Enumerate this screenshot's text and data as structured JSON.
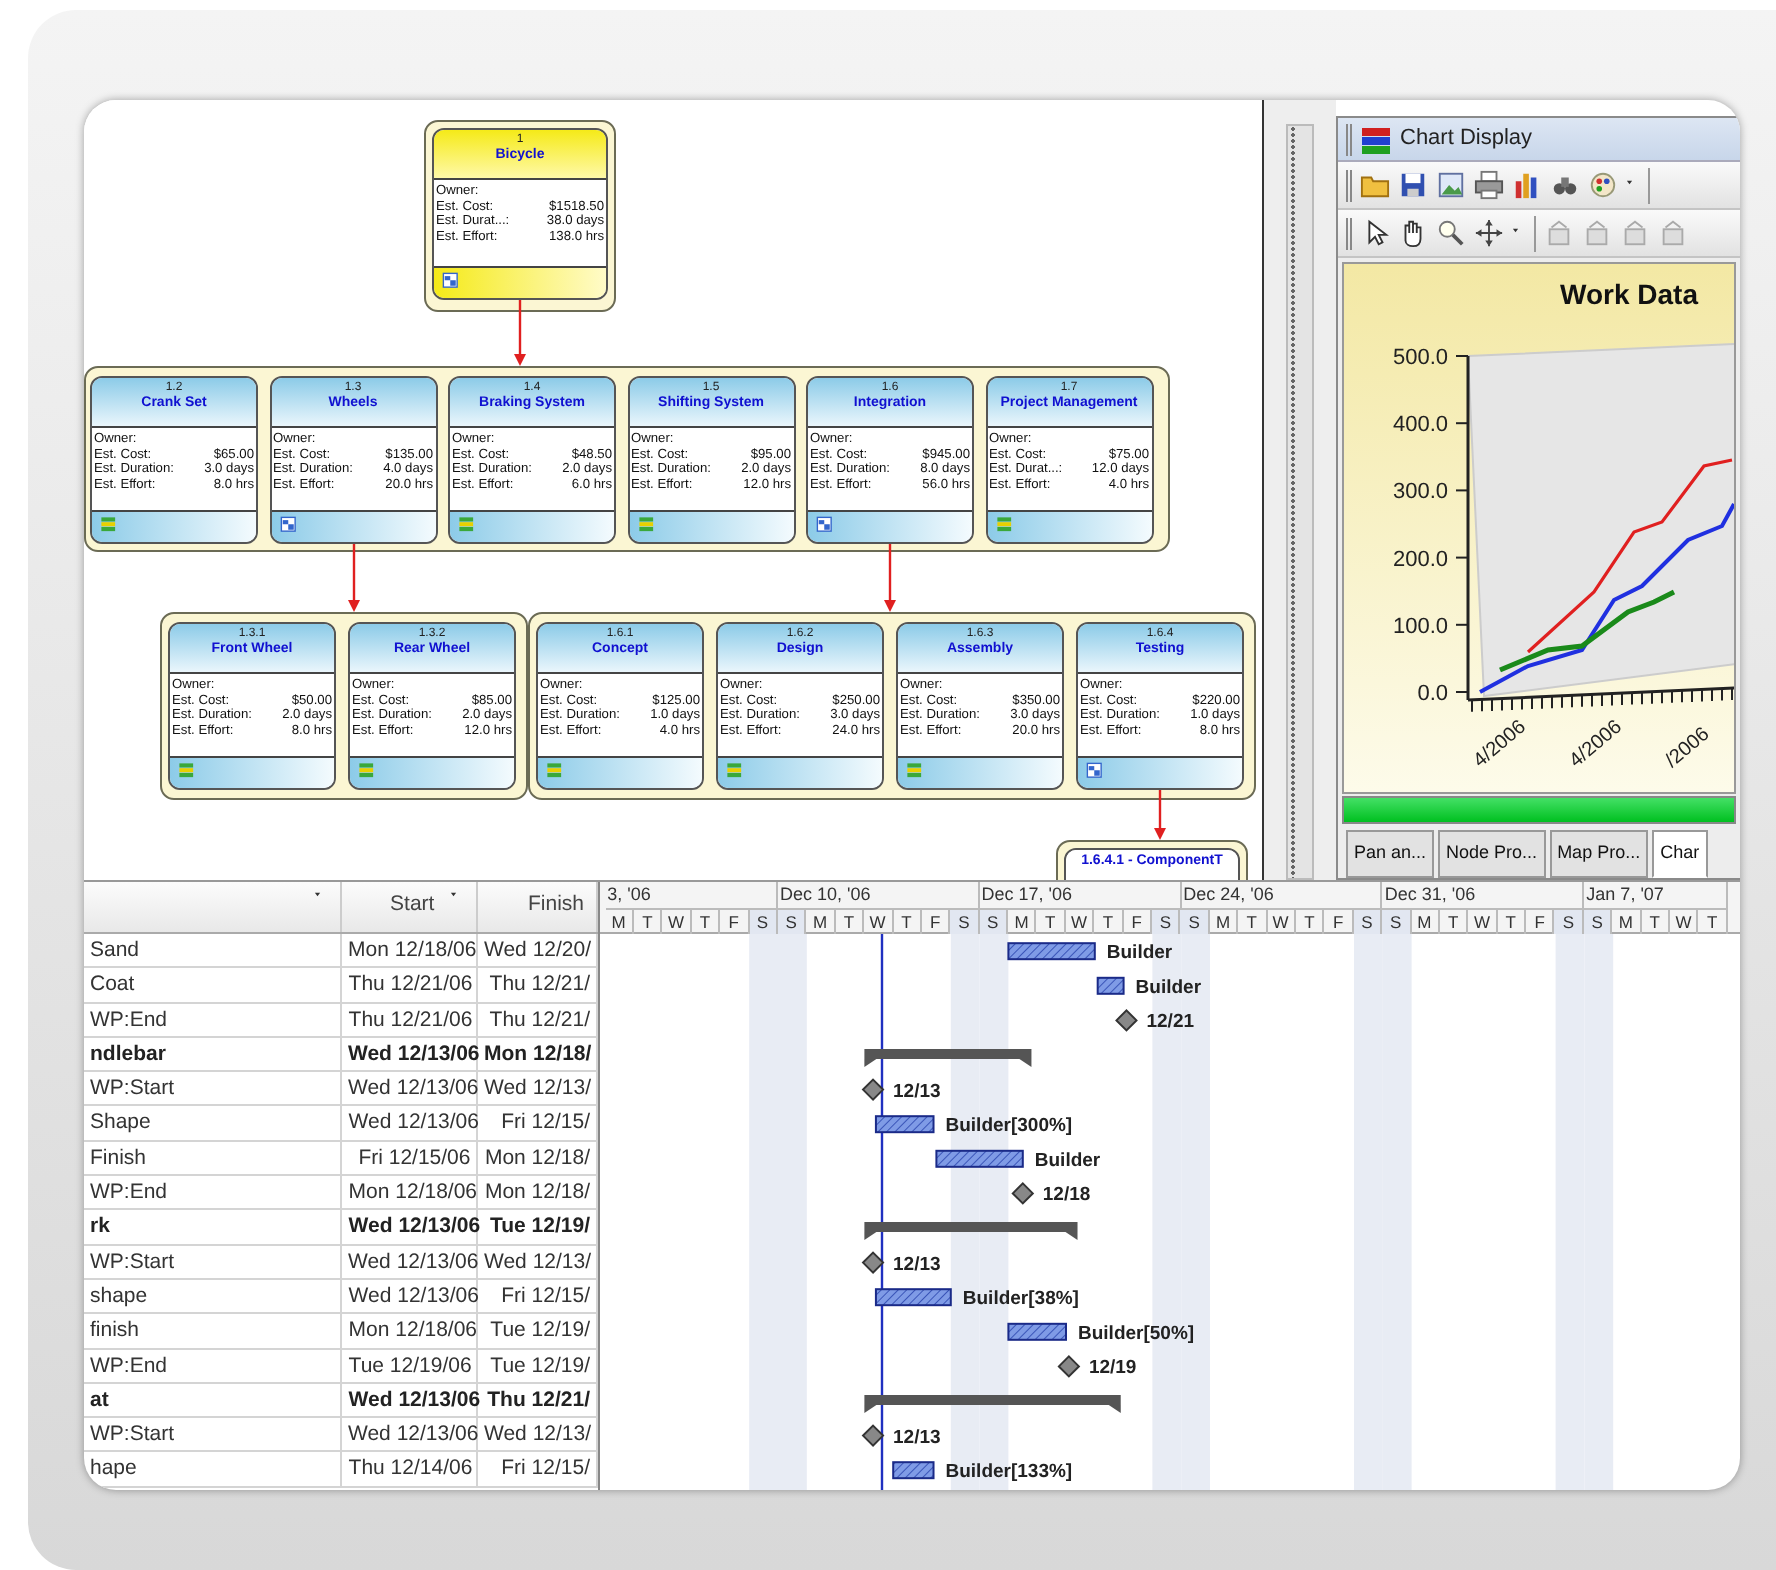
{
  "wbs_map": {
    "root": {
      "number": "1",
      "name": "Bicycle",
      "fields": [
        {
          "label": "Owner:"
        },
        {
          "label": "Est. Cost:",
          "value": "$1518.50"
        },
        {
          "label": "Est. Durat...:",
          "value": "38.0 days"
        },
        {
          "label": "Est. Effort:",
          "value": "138.0 hrs"
        }
      ],
      "children": [
        {
          "number": "1.2",
          "name": "Crank Set",
          "fields": [
            {
              "label": "Owner:"
            },
            {
              "label": "Est. Cost:",
              "value": "$65.00"
            },
            {
              "label": "Est. Duration:",
              "value": "3.0 days"
            },
            {
              "label": "Est. Effort:",
              "value": "8.0 hrs"
            }
          ]
        },
        {
          "number": "1.3",
          "name": "Wheels",
          "fields": [
            {
              "label": "Owner:"
            },
            {
              "label": "Est. Cost:",
              "value": "$135.00"
            },
            {
              "label": "Est. Duration:",
              "value": "4.0 days"
            },
            {
              "label": "Est. Effort:",
              "value": "20.0 hrs"
            }
          ],
          "children": [
            {
              "number": "1.3.1",
              "name": "Front Wheel",
              "fields": [
                {
                  "label": "Owner:"
                },
                {
                  "label": "Est. Cost:",
                  "value": "$50.00"
                },
                {
                  "label": "Est. Duration:",
                  "value": "2.0 days"
                },
                {
                  "label": "Est. Effort:",
                  "value": "8.0 hrs"
                }
              ]
            },
            {
              "number": "1.3.2",
              "name": "Rear Wheel",
              "fields": [
                {
                  "label": "Owner:"
                },
                {
                  "label": "Est. Cost:",
                  "value": "$85.00"
                },
                {
                  "label": "Est. Duration:",
                  "value": "2.0 days"
                },
                {
                  "label": "Est. Effort:",
                  "value": "12.0 hrs"
                }
              ]
            }
          ]
        },
        {
          "number": "1.4",
          "name": "Braking System",
          "fields": [
            {
              "label": "Owner:"
            },
            {
              "label": "Est. Cost:",
              "value": "$48.50"
            },
            {
              "label": "Est. Duration:",
              "value": "2.0 days"
            },
            {
              "label": "Est. Effort:",
              "value": "6.0 hrs"
            }
          ]
        },
        {
          "number": "1.5",
          "name": "Shifting System",
          "fields": [
            {
              "label": "Owner:"
            },
            {
              "label": "Est. Cost:",
              "value": "$95.00"
            },
            {
              "label": "Est. Duration:",
              "value": "2.0 days"
            },
            {
              "label": "Est. Effort:",
              "value": "12.0 hrs"
            }
          ]
        },
        {
          "number": "1.6",
          "name": "Integration",
          "fields": [
            {
              "label": "Owner:"
            },
            {
              "label": "Est. Cost:",
              "value": "$945.00"
            },
            {
              "label": "Est. Duration:",
              "value": "8.0 days"
            },
            {
              "label": "Est. Effort:",
              "value": "56.0 hrs"
            }
          ],
          "children": [
            {
              "number": "1.6.1",
              "name": "Concept",
              "fields": [
                {
                  "label": "Owner:"
                },
                {
                  "label": "Est. Cost:",
                  "value": "$125.00"
                },
                {
                  "label": "Est. Duration:",
                  "value": "1.0 days"
                },
                {
                  "label": "Est. Effort:",
                  "value": "4.0 hrs"
                }
              ]
            },
            {
              "number": "1.6.2",
              "name": "Design",
              "fields": [
                {
                  "label": "Owner:"
                },
                {
                  "label": "Est. Cost:",
                  "value": "$250.00"
                },
                {
                  "label": "Est. Duration:",
                  "value": "3.0 days"
                },
                {
                  "label": "Est. Effort:",
                  "value": "24.0 hrs"
                }
              ]
            },
            {
              "number": "1.6.3",
              "name": "Assembly",
              "fields": [
                {
                  "label": "Owner:"
                },
                {
                  "label": "Est. Cost:",
                  "value": "$350.00"
                },
                {
                  "label": "Est. Duration:",
                  "value": "3.0 days"
                },
                {
                  "label": "Est. Effort:",
                  "value": "20.0 hrs"
                }
              ]
            },
            {
              "number": "1.6.4",
              "name": "Testing",
              "fields": [
                {
                  "label": "Owner:"
                },
                {
                  "label": "Est. Cost:",
                  "value": "$220.00"
                },
                {
                  "label": "Est. Duration:",
                  "value": "1.0 days"
                },
                {
                  "label": "Est. Effort:",
                  "value": "8.0 hrs"
                }
              ],
              "children": [
                {
                  "name": "1.6.4.1 - ComponentT"
                }
              ]
            }
          ]
        },
        {
          "number": "1.7",
          "name": "Project Management",
          "fields": [
            {
              "label": "Owner:"
            },
            {
              "label": "Est. Cost:",
              "value": "$75.00"
            },
            {
              "label": "Est. Durat...:",
              "value": "12.0 days"
            },
            {
              "label": "Est. Effort:",
              "value": "4.0 hrs"
            }
          ]
        }
      ]
    }
  },
  "chart_panel": {
    "title": "Chart Display",
    "chart": {
      "title": "Work Data",
      "y_axis_labels": [
        "500.0",
        "400.0",
        "300.0",
        "200.0",
        "100.0",
        "0.0"
      ],
      "x_axis_labels": [
        "4/2006",
        "4/2006",
        "/2006"
      ]
    },
    "progress": {
      "level": 1
    },
    "tabs": [
      {
        "label": "Pan an...",
        "selected": false
      },
      {
        "label": "Node Pro...",
        "selected": false
      },
      {
        "label": "Map Pro...",
        "selected": false
      },
      {
        "label": "Char",
        "selected": true
      }
    ]
  },
  "task_table": {
    "columns": [
      "Start",
      "Finish"
    ],
    "rows": [
      {
        "name": "Sand",
        "start": "Mon 12/18/06",
        "finish": "Wed 12/20/",
        "kind": "task",
        "bar_label": "Builder"
      },
      {
        "name": "Coat",
        "start": "Thu 12/21/06",
        "finish": "Thu 12/21/",
        "kind": "task",
        "bar_label": "Builder"
      },
      {
        "name": "WP:End",
        "start": "Thu 12/21/06",
        "finish": "Thu 12/21/",
        "kind": "milestone",
        "bar_label": "12/21"
      },
      {
        "name": "ndlebar",
        "start": "Wed 12/13/06",
        "finish": "Mon 12/18/",
        "kind": "summary"
      },
      {
        "name": "WP:Start",
        "start": "Wed 12/13/06",
        "finish": "Wed 12/13/",
        "kind": "milestone",
        "bar_label": "12/13"
      },
      {
        "name": "Shape",
        "start": "Wed 12/13/06",
        "finish": "Fri 12/15/",
        "kind": "task",
        "bar_label": "Builder[300%]"
      },
      {
        "name": "Finish",
        "start": "Fri 12/15/06",
        "finish": "Mon 12/18/",
        "kind": "task",
        "bar_label": "Builder"
      },
      {
        "name": "WP:End",
        "start": "Mon 12/18/06",
        "finish": "Mon 12/18/",
        "kind": "milestone",
        "bar_label": "12/18"
      },
      {
        "name": "rk",
        "start": "Wed 12/13/06",
        "finish": "Tue 12/19/",
        "kind": "summary"
      },
      {
        "name": "WP:Start",
        "start": "Wed 12/13/06",
        "finish": "Wed 12/13/",
        "kind": "milestone",
        "bar_label": "12/13"
      },
      {
        "name": "shape",
        "start": "Wed 12/13/06",
        "finish": "Fri 12/15/",
        "kind": "task",
        "bar_label": "Builder[38%]"
      },
      {
        "name": "finish",
        "start": "Mon 12/18/06",
        "finish": "Tue 12/19/",
        "kind": "task",
        "bar_label": "Builder[50%]"
      },
      {
        "name": "WP:End",
        "start": "Tue 12/19/06",
        "finish": "Tue 12/19/",
        "kind": "milestone",
        "bar_label": "12/19"
      },
      {
        "name": "at",
        "start": "Wed 12/13/06",
        "finish": "Thu 12/21/",
        "kind": "summary"
      },
      {
        "name": "WP:Start",
        "start": "Wed 12/13/06",
        "finish": "Wed 12/13/",
        "kind": "milestone",
        "bar_label": "12/13"
      },
      {
        "name": "hape",
        "start": "Thu 12/14/06",
        "finish": "Fri 12/15/",
        "kind": "task",
        "bar_label": "Builder[133%]"
      }
    ]
  },
  "gantt": {
    "weeks": [
      {
        "label": "3, '06",
        "days": [
          {
            "label": "M",
            "weekend": false
          },
          {
            "label": "T",
            "weekend": false
          },
          {
            "label": "W",
            "weekend": false
          },
          {
            "label": "T",
            "weekend": false
          },
          {
            "label": "F",
            "weekend": false
          },
          {
            "label": "S",
            "weekend": true
          }
        ]
      },
      {
        "label": "Dec 10, '06",
        "days": [
          {
            "label": "S",
            "weekend": true
          },
          {
            "label": "M",
            "weekend": false
          },
          {
            "label": "T",
            "weekend": false
          },
          {
            "label": "W",
            "weekend": false
          },
          {
            "label": "T",
            "weekend": false
          },
          {
            "label": "F",
            "weekend": false
          },
          {
            "label": "S",
            "weekend": true
          }
        ]
      },
      {
        "label": "Dec 17, '06",
        "days": [
          {
            "label": "S",
            "weekend": true
          },
          {
            "label": "M",
            "weekend": false
          },
          {
            "label": "T",
            "weekend": false
          },
          {
            "label": "W",
            "weekend": false
          },
          {
            "label": "T",
            "weekend": false
          },
          {
            "label": "F",
            "weekend": false
          },
          {
            "label": "S",
            "weekend": true
          }
        ]
      },
      {
        "label": "Dec 24, '06",
        "days": [
          {
            "label": "S",
            "weekend": true
          },
          {
            "label": "M",
            "weekend": false
          },
          {
            "label": "T",
            "weekend": false
          },
          {
            "label": "W",
            "weekend": false
          },
          {
            "label": "T",
            "weekend": false
          },
          {
            "label": "F",
            "weekend": false
          },
          {
            "label": "S",
            "weekend": true
          }
        ]
      },
      {
        "label": "Dec 31, '06",
        "days": [
          {
            "label": "S",
            "weekend": true
          },
          {
            "label": "M",
            "weekend": false
          },
          {
            "label": "T",
            "weekend": false
          },
          {
            "label": "W",
            "weekend": false
          },
          {
            "label": "T",
            "weekend": false
          },
          {
            "label": "F",
            "weekend": false
          },
          {
            "label": "S",
            "weekend": true
          }
        ]
      },
      {
        "label": "Jan 7, '07",
        "days": [
          {
            "label": "S",
            "weekend": true
          },
          {
            "label": "M",
            "weekend": false
          },
          {
            "label": "T",
            "weekend": false
          },
          {
            "label": "W",
            "weekend": false
          },
          {
            "label": "T",
            "weekend": false
          }
        ]
      }
    ]
  }
}
